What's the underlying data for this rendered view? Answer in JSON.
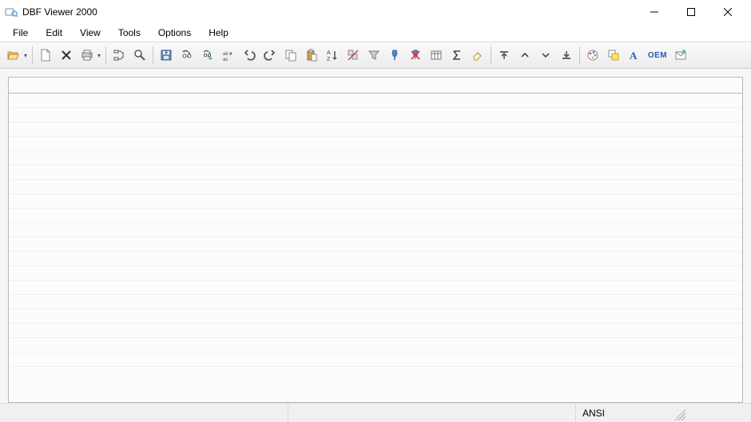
{
  "app": {
    "title": "DBF Viewer 2000"
  },
  "menu": {
    "items": [
      "File",
      "Edit",
      "View",
      "Tools",
      "Options",
      "Help"
    ]
  },
  "toolbar": {
    "open": "Open",
    "new": "New",
    "delete": "Delete",
    "print": "Print",
    "structure": "Structure",
    "zoom": "Zoom",
    "save": "Save",
    "find": "Find",
    "findnext": "Find Next",
    "replace": "Replace",
    "undo": "Undo",
    "redo": "Redo",
    "copy": "Copy",
    "paste": "Paste",
    "sortaz": "Sort A-Z",
    "filter_icon1": "Remove Duplicates",
    "filter_funnel": "Filter",
    "filter_pin": "Set Filter",
    "filter_clear": "Clear Filter",
    "columns": "Columns",
    "sum": "Sum",
    "clear": "Clear",
    "top": "First",
    "up": "Page Up",
    "down": "Page Down",
    "bottom": "Last",
    "color": "Colors",
    "fill": "Highlight",
    "font": "Font",
    "oem": "OEM",
    "mail": "Export"
  },
  "status": {
    "encoding": "ANSI"
  }
}
